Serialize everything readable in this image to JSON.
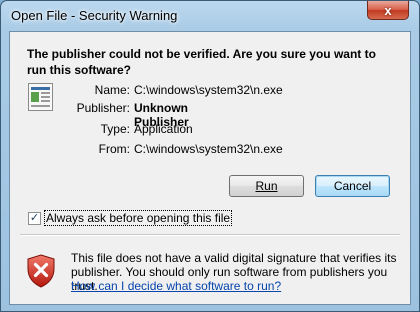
{
  "window": {
    "title": "Open File - Security Warning",
    "close_glyph": "x"
  },
  "heading": "The publisher could not be verified.  Are you sure you want to run this software?",
  "properties": [
    {
      "label": "Name:",
      "value": "C:\\windows\\system32\\n.exe"
    },
    {
      "label": "Publisher:",
      "value": "Unknown Publisher"
    },
    {
      "label": "Type:",
      "value": "Application"
    },
    {
      "label": "From:",
      "value": "C:\\windows\\system32\\n.exe"
    }
  ],
  "buttons": {
    "run_label": "Run",
    "cancel_label": "Cancel"
  },
  "checkbox": {
    "label": "Always ask before opening this file",
    "checked": true,
    "glyph": "✓"
  },
  "warning": {
    "text": "This file does not have a valid digital signature that verifies its publisher.  You should only run software from publishers you trust.",
    "link": "How can I decide what software to run?"
  },
  "icons": {
    "file": "application-file-icon",
    "shield": "security-shield-error-icon"
  }
}
